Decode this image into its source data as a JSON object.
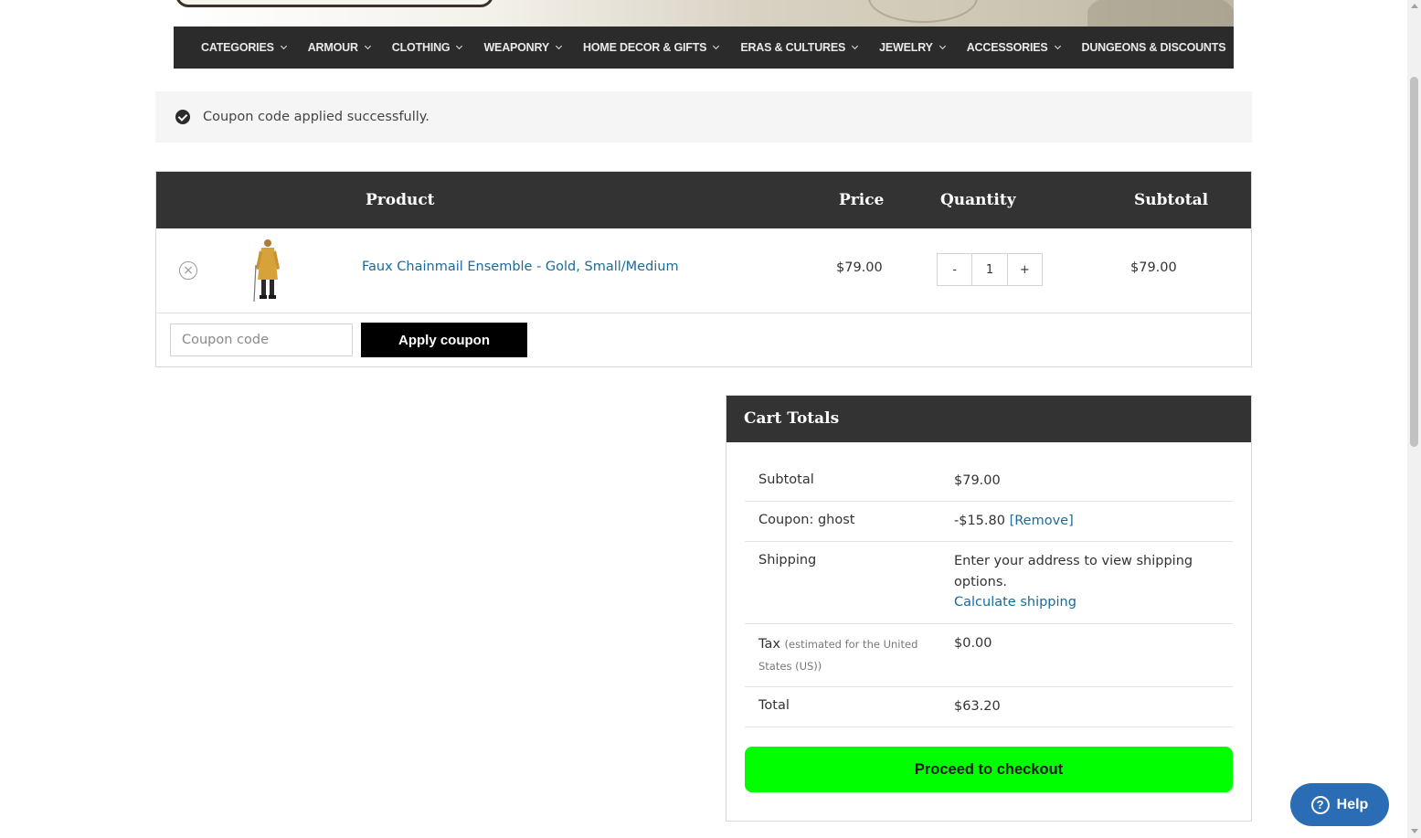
{
  "nav": {
    "items": [
      {
        "label": "CATEGORIES",
        "has_dropdown": true
      },
      {
        "label": "ARMOUR",
        "has_dropdown": true
      },
      {
        "label": "CLOTHING",
        "has_dropdown": true
      },
      {
        "label": "WEAPONRY",
        "has_dropdown": true
      },
      {
        "label": "HOME DECOR & GIFTS",
        "has_dropdown": true
      },
      {
        "label": "ERAS & CULTURES",
        "has_dropdown": true
      },
      {
        "label": "JEWELRY",
        "has_dropdown": true
      },
      {
        "label": "ACCESSORIES",
        "has_dropdown": true
      },
      {
        "label": "DUNGEONS & DISCOUNTS",
        "has_dropdown": false
      }
    ]
  },
  "notice": {
    "message": "Coupon code applied successfully.",
    "icon": "check-circle-icon"
  },
  "cart": {
    "headers": {
      "product": "Product",
      "price": "Price",
      "quantity": "Quantity",
      "subtotal": "Subtotal"
    },
    "items": [
      {
        "name": "Faux Chainmail Ensemble - Gold, Small/Medium",
        "price": "$79.00",
        "quantity": "1",
        "subtotal": "$79.00",
        "remove_icon": "×",
        "qty_minus": "-",
        "qty_plus": "+"
      }
    ],
    "coupon": {
      "placeholder": "Coupon code",
      "apply_label": "Apply coupon"
    }
  },
  "totals": {
    "title": "Cart Totals",
    "subtotal_label": "Subtotal",
    "subtotal_value": "$79.00",
    "coupon_label": "Coupon: ghost",
    "coupon_value": "-$15.80",
    "coupon_remove": "[Remove]",
    "shipping_label": "Shipping",
    "shipping_text": "Enter your address to view shipping options.",
    "shipping_link": "Calculate shipping",
    "tax_label": "Tax",
    "tax_note": "(estimated for the United States (US))",
    "tax_value": "$0.00",
    "total_label": "Total",
    "total_value": "$63.20",
    "checkout_label": "Proceed to checkout",
    "checkout_color": "#00ff00"
  },
  "help": {
    "label": "Help",
    "icon": "question-circle-icon",
    "color": "#2a6db5"
  }
}
